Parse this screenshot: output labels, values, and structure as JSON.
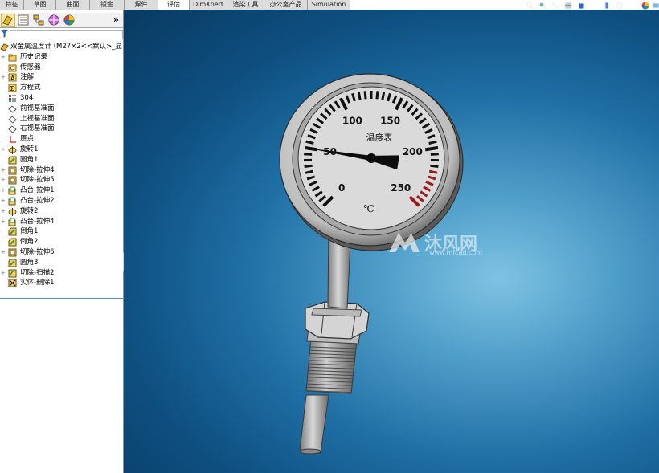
{
  "command_tabs": [
    {
      "label": "特征",
      "active": false
    },
    {
      "label": "草图",
      "active": false
    },
    {
      "label": "曲面",
      "active": false
    },
    {
      "label": "钣金",
      "active": false
    },
    {
      "label": "焊件",
      "active": false
    },
    {
      "label": "评估",
      "active": true
    },
    {
      "label": "DimXpert",
      "active": false
    },
    {
      "label": "渲染工具",
      "active": false
    },
    {
      "label": "办公室产品",
      "active": false
    },
    {
      "label": "Simulation",
      "active": false
    }
  ],
  "panel": {
    "more_glyph": "»",
    "tree": [
      {
        "label": "双金属温度计  (M27×2<<默认>_显",
        "icon": "part-icon",
        "expandable": false,
        "root": true
      },
      {
        "label": "历史记录",
        "icon": "history-folder-icon",
        "expandable": true
      },
      {
        "label": "传感器",
        "icon": "sensor-icon",
        "expandable": false
      },
      {
        "label": "注解",
        "icon": "annotations-icon",
        "expandable": true
      },
      {
        "label": "方程式",
        "icon": "equations-icon",
        "expandable": false
      },
      {
        "label": "304",
        "icon": "material-icon",
        "expandable": false
      },
      {
        "label": "前视基准面",
        "icon": "plane-icon",
        "expandable": false
      },
      {
        "label": "上视基准面",
        "icon": "plane-icon",
        "expandable": false
      },
      {
        "label": "右视基准面",
        "icon": "plane-icon",
        "expandable": false
      },
      {
        "label": "原点",
        "icon": "origin-icon",
        "expandable": false
      },
      {
        "label": "旋转1",
        "icon": "revolve-icon",
        "expandable": true
      },
      {
        "label": "圆角1",
        "icon": "fillet-icon",
        "expandable": false
      },
      {
        "label": "切除-拉伸4",
        "icon": "cut-extrude-icon",
        "expandable": true
      },
      {
        "label": "切除-拉伸5",
        "icon": "cut-extrude-icon",
        "expandable": true
      },
      {
        "label": "凸台-拉伸1",
        "icon": "boss-extrude-icon",
        "expandable": true
      },
      {
        "label": "凸台-拉伸2",
        "icon": "boss-extrude-icon",
        "expandable": true
      },
      {
        "label": "旋转2",
        "icon": "revolve-icon",
        "expandable": true
      },
      {
        "label": "凸台-拉伸4",
        "icon": "boss-extrude-icon",
        "expandable": true
      },
      {
        "label": "倒角1",
        "icon": "chamfer-icon",
        "expandable": false
      },
      {
        "label": "倒角2",
        "icon": "chamfer-icon",
        "expandable": false
      },
      {
        "label": "切除-拉伸6",
        "icon": "cut-extrude-icon",
        "expandable": true
      },
      {
        "label": "圆角3",
        "icon": "fillet-icon",
        "expandable": false
      },
      {
        "label": "切除-扫描2",
        "icon": "cut-sweep-icon",
        "expandable": true
      },
      {
        "label": "实体-删除1",
        "icon": "delete-body-icon",
        "expandable": false
      }
    ]
  },
  "gauge": {
    "title": "温度表",
    "unit": "℃",
    "scale_labels": [
      "0",
      "50",
      "100",
      "150",
      "200",
      "250"
    ],
    "scale_min": 0,
    "scale_max": 250,
    "needle_value": 50,
    "red_zone_from": 220
  },
  "watermark": {
    "text": "沐风网",
    "url": "www.mfcad.com"
  },
  "colors": {
    "viewport_center": "#7fc3e3",
    "viewport_edge": "#083a61",
    "red_zone": "#9b1b1b",
    "dial_face": "#d8d8d8",
    "tree_end_line": "#4a8fd0"
  }
}
